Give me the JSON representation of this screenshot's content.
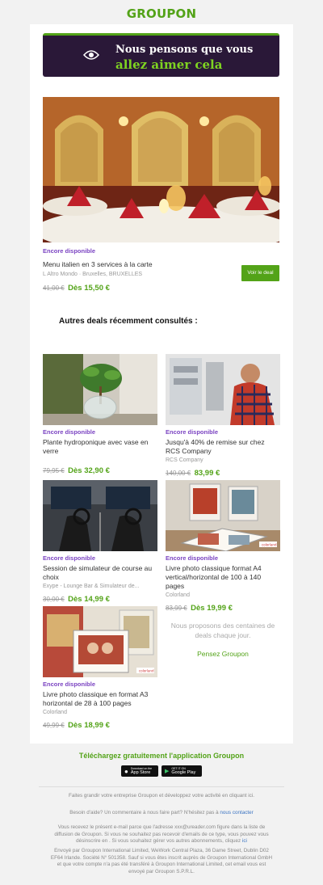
{
  "header": {
    "logo": "GROUPON"
  },
  "banner": {
    "line1": "Nous pensons que vous",
    "line2": "allez aimer cela"
  },
  "hero": {
    "availability": "Encore disponible",
    "title": "Menu italien en 3 services à la carte",
    "merchant": "L Altro Mondo",
    "location": "Bruxelles, BRUXELLES",
    "old_price": "41,00 €",
    "price": "Dès 15,50 €",
    "cta": "Voir le deal"
  },
  "recent_title": "Autres deals récemment consultés :",
  "deals": [
    {
      "availability": "Encore disponible",
      "title": "Plante hydroponique avec vase en verre",
      "merchant": "",
      "old_price": "79,95 €",
      "price": "Dès 32,90 €"
    },
    {
      "availability": "Encore disponible",
      "title": "Jusqu'à 40% de remise sur chez RCS Company",
      "merchant": "RCS Company",
      "old_price": "140,00 €",
      "price": "83,99 €"
    },
    {
      "availability": "Encore disponible",
      "title": "Session de simulateur de course au choix",
      "merchant": "Exype - Lounge Bar & Simulateur de...",
      "old_price": "30,00 €",
      "price": "Dès 14,99 €"
    },
    {
      "availability": "Encore disponible",
      "title": "Livre photo classique format A4 vertical/horizontal de 100 à 140 pages",
      "merchant": "Colorland",
      "old_price": "83,99 €",
      "price": "Dès 19,99 €"
    },
    {
      "availability": "Encore disponible",
      "title": "Livre photo classique en format A3 horizontal de 28 à 100 pages",
      "merchant": "Colorland",
      "old_price": "49,99 €",
      "price": "Dès 18,99 €"
    }
  ],
  "promo": {
    "text": "Nous proposons des centaines de deals chaque jour.",
    "link": "Pensez Groupon"
  },
  "app": {
    "title": "Téléchargez gratuitement l'application Groupon",
    "appstore_small": "Download on the",
    "appstore": "App Store",
    "googleplay_small": "GET IT ON",
    "googleplay": "Google Play"
  },
  "footer": {
    "business": "Faites grandir votre entreprise Groupon et développez votre activité en cliquant ici.",
    "help": "Besoin d'aide? Un commentaire à nous faire part? N'hésitez pas à",
    "help_link": "nous contacter",
    "unsubscribe": "Vous recevez le présent e-mail parce que l'adresse xxx@ureader.com figure dans la liste de diffusion de Groupon. Si vous ne souhaitez pas recevoir d'emails de ce type, vous pouvez vous désinscrire en . Si vous souhaitez gérer vos autres abonnements, cliquez",
    "unsubscribe_link": "ici",
    "legal": "Envoyé par Groupon International Limited, WeWork Central Plaza, 36 Dame Street, Dublin D02 EF64 Irlande. Société N° 501358. Sauf si vous êtes inscrit auprès de Groupon International GmbH et que votre compte n'a pas été transféré à Groupon International Limited, cet email vous est envoyé par Groupon S.P.R.L."
  },
  "colors": {
    "brand_green": "#53a318",
    "accent_purple": "#7b44c2",
    "banner_bg": "#2a1838"
  }
}
